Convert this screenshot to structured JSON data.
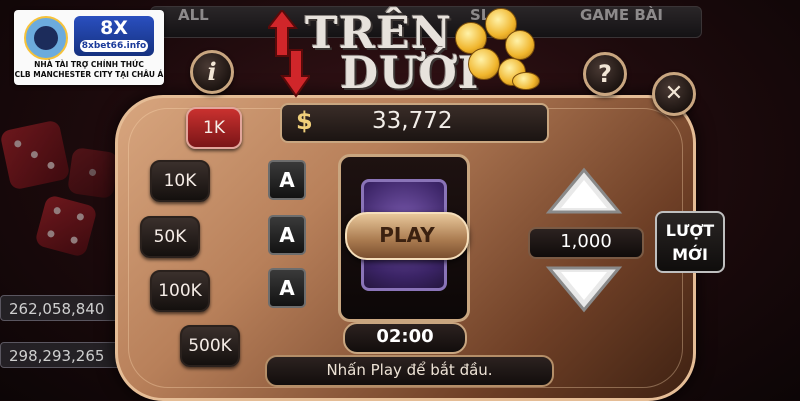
{
  "background": {
    "tabs": [
      "ALL",
      "SL",
      "GAME BÀI"
    ],
    "counters": [
      "262,058,840",
      "298,293,265"
    ]
  },
  "logo": {
    "brand": "8X",
    "brand_sub": "bet",
    "domain": "8xbet66.info",
    "caption_line1": "NHÀ TÀI TRỢ CHÍNH THỨC",
    "caption_line2": "CLB MANCHESTER CITY TẠI CHÂU Á",
    "badge_text": "MANCHESTER CITY"
  },
  "title": {
    "line1": "TRÊN",
    "line2": "DƯỚI"
  },
  "buttons": {
    "info": "i",
    "help": "?",
    "close": "✕",
    "play": "PLAY",
    "luot_line1": "LƯỢT",
    "luot_line2": "MỚI"
  },
  "balance": {
    "currency": "$",
    "value": "33,772"
  },
  "chips": [
    "1K",
    "10K",
    "50K",
    "100K",
    "500K"
  ],
  "selected_chip": "1K",
  "cards": [
    "A",
    "A",
    "A"
  ],
  "bet_amount": "1,000",
  "timer": "02:00",
  "hint": "Nhấn Play để bắt đầu.",
  "colors": {
    "gold": "#c9a680",
    "chip_active": "#c9312f",
    "panel": "#b8805a"
  }
}
